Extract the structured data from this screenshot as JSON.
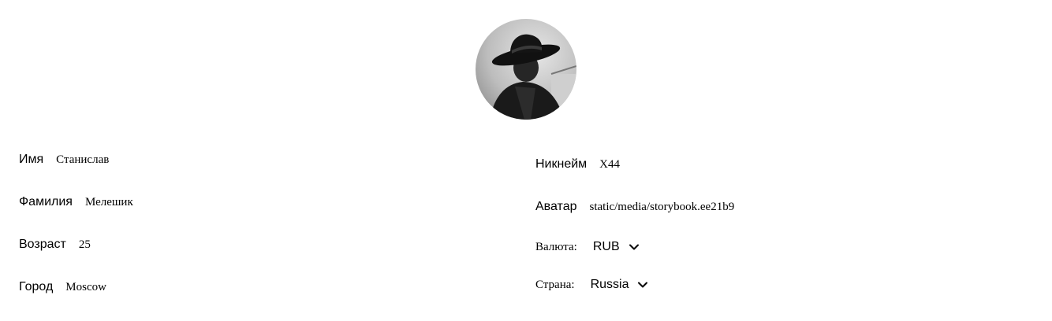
{
  "profile": {
    "avatar_alt": "avatar",
    "fields_left": [
      {
        "label": "Имя",
        "value": "Станислав"
      },
      {
        "label": "Фамилия",
        "value": "Мелешик"
      },
      {
        "label": "Возраст",
        "value": "25"
      },
      {
        "label": "Город",
        "value": "Moscow"
      }
    ],
    "fields_right": [
      {
        "label": "Никнейм",
        "value": "X44"
      },
      {
        "label": "Аватар",
        "value": "static/media/storybook.ee21b9"
      }
    ],
    "currency": {
      "label": "Валюта:",
      "value": "RUB"
    },
    "country": {
      "label": "Страна:",
      "value": "Russia"
    }
  },
  "icons": {
    "chevron": "chevron-down-icon"
  }
}
